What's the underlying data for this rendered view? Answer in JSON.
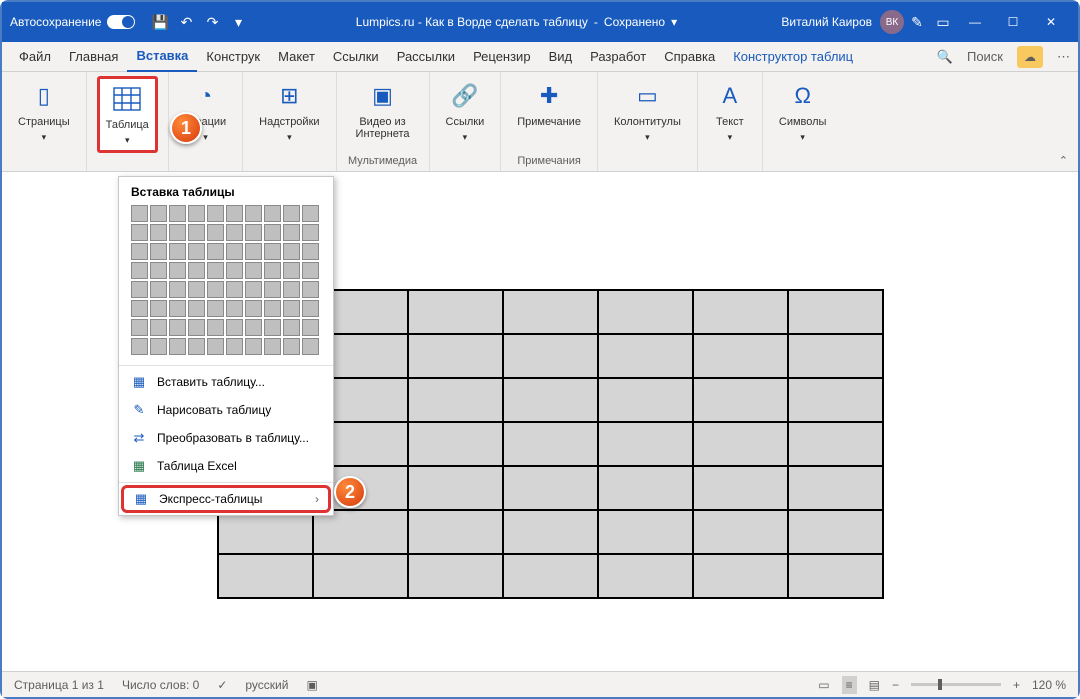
{
  "titlebar": {
    "autosave": "Автосохранение",
    "doc_title": "Lumpics.ru - Как в Ворде сделать таблицу",
    "saved": "Сохранено",
    "user": "Виталий Каиров",
    "avatar": "ВК"
  },
  "tabs": {
    "file": "Файл",
    "home": "Главная",
    "insert": "Вставка",
    "design": "Конструк",
    "layout": "Макет",
    "references": "Ссылки",
    "mailings": "Рассылки",
    "review": "Рецензир",
    "view": "Вид",
    "developer": "Разработ",
    "help": "Справка",
    "table_design": "Конструктор таблиц",
    "search": "Поиск"
  },
  "ribbon": {
    "pages": "Страницы",
    "table": "Таблица",
    "illustrations": "страции",
    "addins": "Надстройки",
    "video": "Видео из Интернета",
    "multimedia": "Мультимедиа",
    "links": "Ссылки",
    "comment": "Примечание",
    "comments": "Примечания",
    "headerfooter": "Колонтитулы",
    "text": "Текст",
    "symbols": "Символы"
  },
  "dropdown": {
    "title": "Вставка таблицы",
    "insert_table": "Вставить таблицу...",
    "draw_table": "Нарисовать таблицу",
    "convert": "Преобразовать в таблицу...",
    "excel": "Таблица Excel",
    "quick": "Экспресс-таблицы"
  },
  "status": {
    "page": "Страница 1 из 1",
    "words": "Число слов: 0",
    "lang": "русский",
    "zoom": "120 %"
  },
  "callouts": {
    "one": "1",
    "two": "2"
  }
}
